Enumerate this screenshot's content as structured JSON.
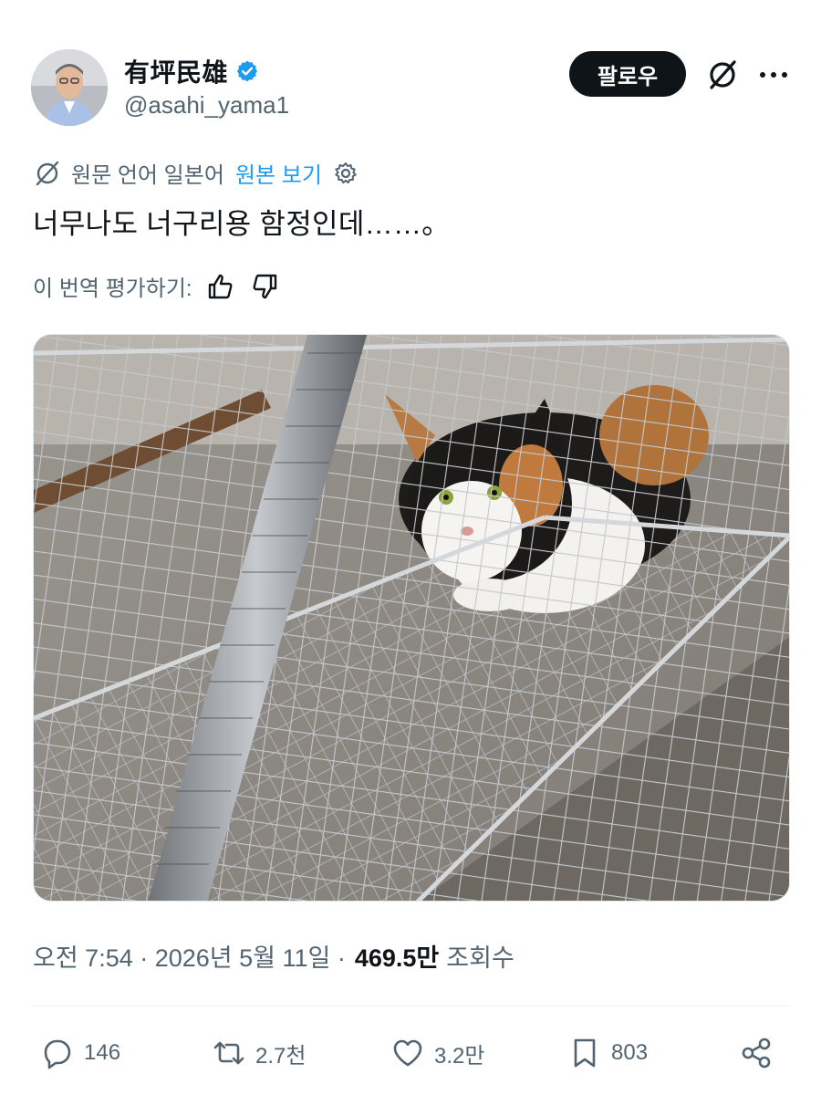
{
  "author": {
    "display_name": "有坪民雄",
    "handle": "@asahi_yama1",
    "verified": true
  },
  "header": {
    "follow_label": "팔로우"
  },
  "translation": {
    "source_info": "원문 언어 일본어",
    "show_original": "원본 보기"
  },
  "tweet": {
    "text": "너무나도 너구리용 함정인데……。"
  },
  "rating": {
    "label": "이 번역 평가하기:"
  },
  "meta": {
    "timestamp": "오전 7:54 · 2026년 5월 11일 ·",
    "views": "469.5만",
    "views_label": "조회수"
  },
  "actions": {
    "replies": "146",
    "reposts": "2.7천",
    "likes": "3.2만",
    "bookmarks": "803"
  },
  "colors": {
    "accent": "#1d9bf0",
    "text": "#0f1419",
    "muted": "#536471"
  }
}
